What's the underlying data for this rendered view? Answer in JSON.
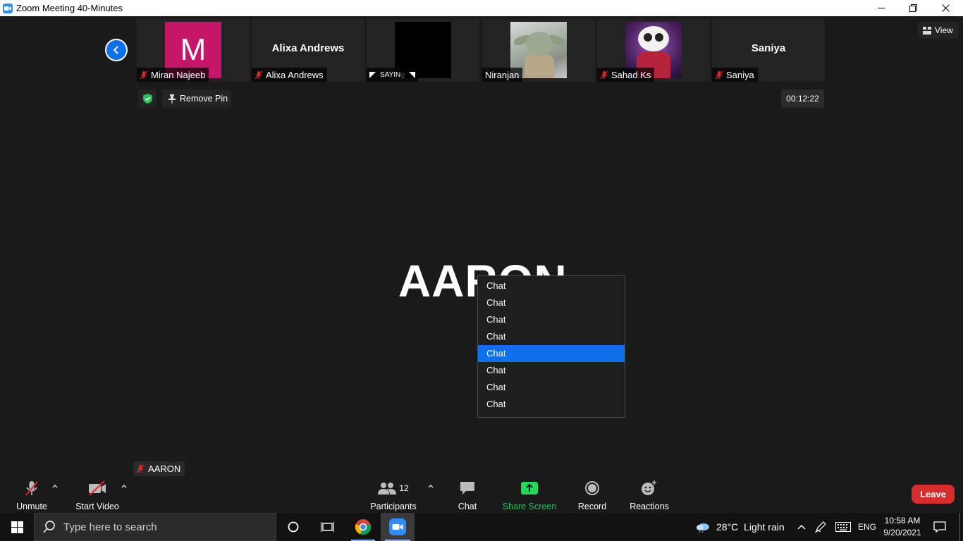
{
  "window": {
    "title": "Zoom Meeting 40-Minutes",
    "app_icon": "zoom-camera-icon",
    "controls": [
      "minimize-icon",
      "restore-icon",
      "close-icon"
    ]
  },
  "participants_strip": [
    {
      "name": "Miran Najeeb",
      "avatar_letter": "M",
      "avatar_color": "#c5166a",
      "muted": true
    },
    {
      "name": "Alixa Andrews",
      "display_name": "Alixa Andrews",
      "muted": true
    },
    {
      "name": "SAYIN◌̱",
      "video": "black",
      "muted": false
    },
    {
      "name": "Niranjan",
      "video": "photo",
      "muted": false
    },
    {
      "name": "Sahad Ks",
      "video": "photo",
      "muted": true
    },
    {
      "name": "Saniya",
      "display_name": "Saniya",
      "muted": true
    }
  ],
  "meeting": {
    "remove_pin_label": "Remove Pin",
    "timer": "00:12:22",
    "view_label": "View",
    "active_speaker": "AARON",
    "self_name": "AARON"
  },
  "dropdown": {
    "options": [
      "Chat",
      "Chat",
      "Chat",
      "Chat",
      "Chat",
      "Chat",
      "Chat",
      "Chat"
    ],
    "selected_index": 4
  },
  "toolbar": {
    "unmute": "Unmute",
    "start_video": "Start Video",
    "participants": "Participants",
    "participants_count": "12",
    "chat": "Chat",
    "share_screen": "Share Screen",
    "record": "Record",
    "reactions": "Reactions",
    "leave": "Leave"
  },
  "taskbar": {
    "search_placeholder": "Type here to search",
    "weather": "28°C  Light rain",
    "language": "ENG",
    "time": "10:58 AM",
    "date": "9/20/2021"
  },
  "colors": {
    "accent_blue": "#0e71eb",
    "leave_red": "#d92c2c",
    "share_green": "#23d959",
    "muted_red": "#e02828"
  }
}
